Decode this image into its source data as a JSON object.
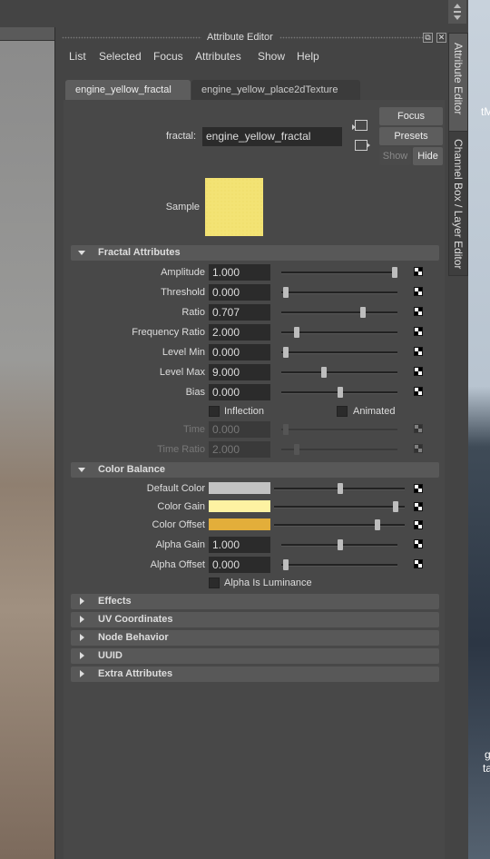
{
  "window": {
    "title": "Attribute Editor",
    "restore_glyph": "⧉",
    "close_glyph": "✕"
  },
  "menu": [
    "List",
    "Selected",
    "Focus",
    "Attributes",
    "Show",
    "Help"
  ],
  "tabs": [
    "engine_yellow_fractal",
    "engine_yellow_place2dTexture"
  ],
  "side_tabs": [
    "Attribute Editor",
    "Channel Box / Layer Editor"
  ],
  "node": {
    "label": "fractal:",
    "value": "engine_yellow_fractal"
  },
  "buttons": {
    "focus": "Focus",
    "presets": "Presets",
    "show": "Show",
    "hide": "Hide"
  },
  "sample": {
    "label": "Sample",
    "color": "#f3e374"
  },
  "fractal_attributes": {
    "title": "Fractal Attributes",
    "rows": [
      {
        "label": "Amplitude",
        "value": "1.000",
        "slider": 1.0
      },
      {
        "label": "Threshold",
        "value": "0.000",
        "slider": 0.0
      },
      {
        "label": "Ratio",
        "value": "0.707",
        "slider": 0.707
      },
      {
        "label": "Frequency Ratio",
        "value": "2.000",
        "slider": 0.1
      },
      {
        "label": "Level Min",
        "value": "0.000",
        "slider": 0.0
      },
      {
        "label": "Level Max",
        "value": "9.000",
        "slider": 0.35
      },
      {
        "label": "Bias",
        "value": "0.000",
        "slider": 0.5
      }
    ],
    "inflection": "Inflection",
    "animated": "Animated",
    "disabled_rows": [
      {
        "label": "Time",
        "value": "0.000",
        "slider": 0.0
      },
      {
        "label": "Time Ratio",
        "value": "2.000",
        "slider": 0.1
      }
    ]
  },
  "color_balance": {
    "title": "Color Balance",
    "color_rows": [
      {
        "label": "Default Color",
        "color": "#c2c2c2",
        "slider": 0.5
      },
      {
        "label": "Color Gain",
        "color": "#fdf2a2",
        "slider": 0.95
      },
      {
        "label": "Color Offset",
        "color": "#e3ae3a",
        "slider": 0.8
      }
    ],
    "value_rows": [
      {
        "label": "Alpha Gain",
        "value": "1.000",
        "slider": 0.5
      },
      {
        "label": "Alpha Offset",
        "value": "0.000",
        "slider": 0.0
      }
    ],
    "alpha_is_luminance": "Alpha Is Luminance"
  },
  "collapsed_sections": [
    "Effects",
    "UV Coordinates",
    "Node Behavior",
    "UUID",
    "Extra Attributes"
  ],
  "desktop_text": {
    "top": "tM",
    "bottom1": "g",
    "bottom2": "ta"
  }
}
